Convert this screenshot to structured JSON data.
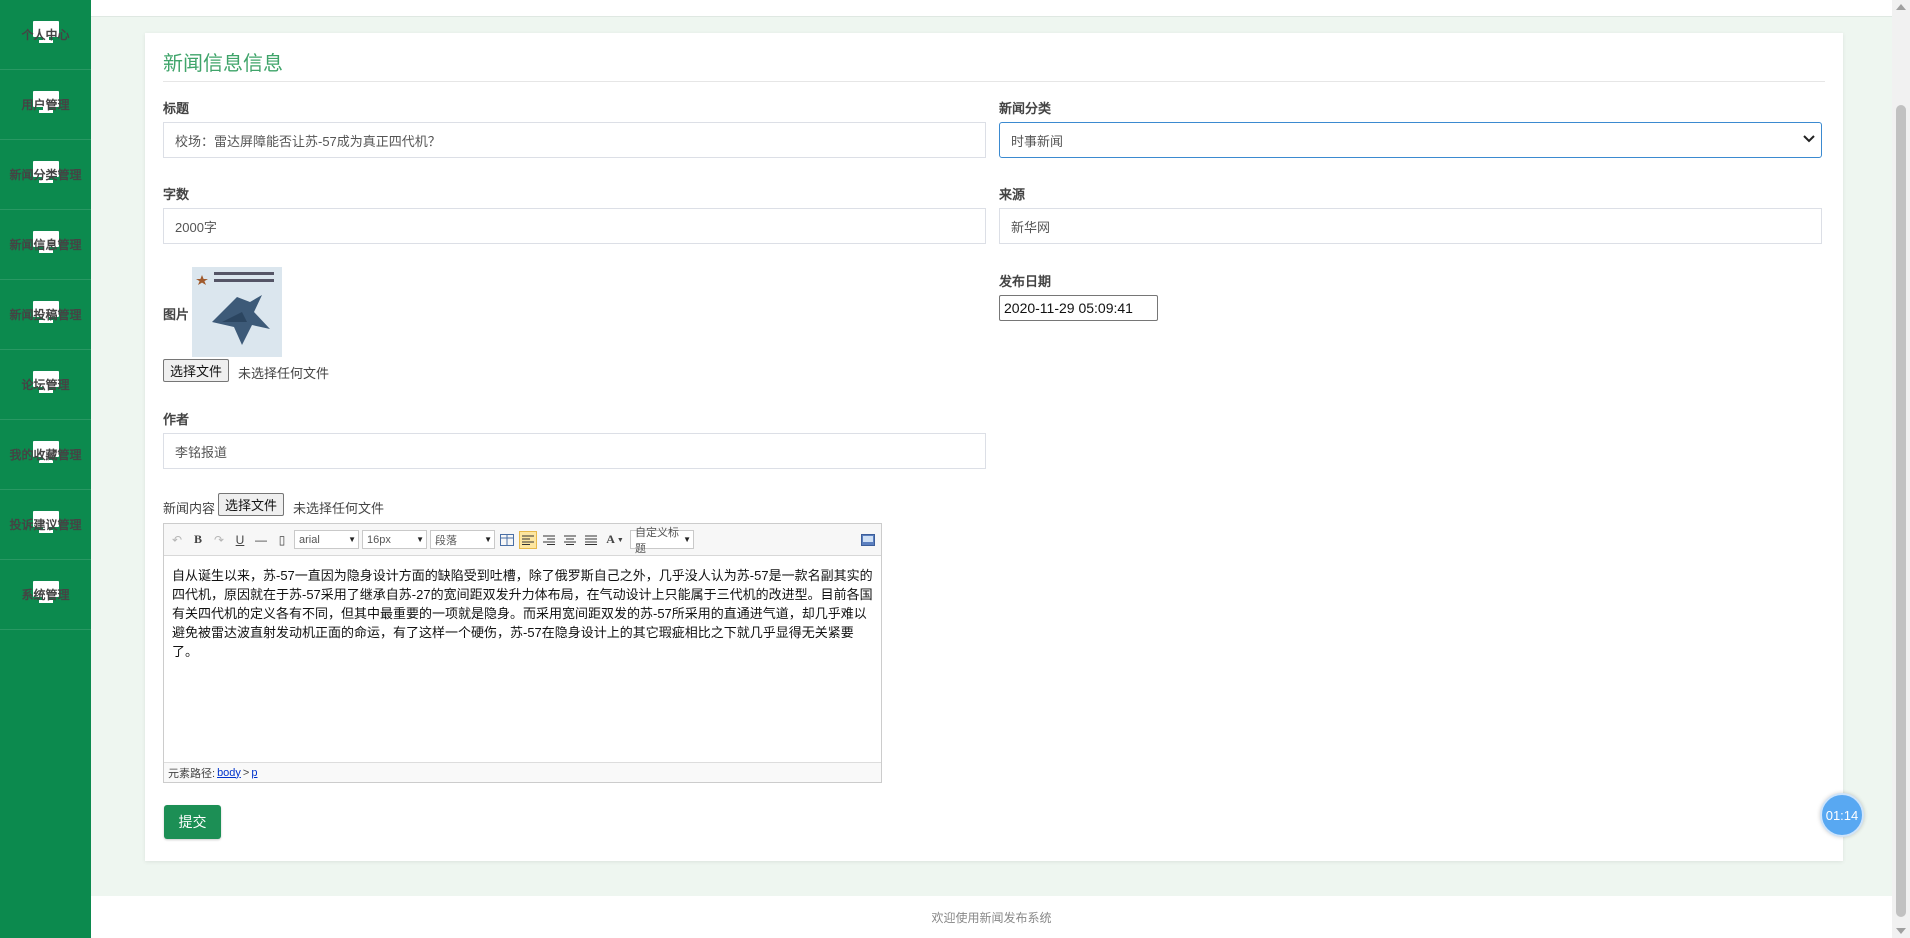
{
  "sidebar": {
    "items": [
      {
        "label": "个人中心"
      },
      {
        "label": "用户管理"
      },
      {
        "label": "新闻分类管理"
      },
      {
        "label": "新闻信息管理"
      },
      {
        "label": "新闻投稿管理"
      },
      {
        "label": "论坛管理"
      },
      {
        "label": "我的收藏管理"
      },
      {
        "label": "投诉建议管理"
      },
      {
        "label": "系统管理"
      }
    ]
  },
  "form": {
    "title": "新闻信息信息",
    "headline_label": "标题",
    "headline_value": "校场：雷达屏障能否让苏-57成为真正四代机？",
    "category_label": "新闻分类",
    "category_value": "时事新闻",
    "wordcount_label": "字数",
    "wordcount_value": "2000字",
    "source_label": "来源",
    "source_value": "新华网",
    "image_label": "图片",
    "pubdate_label": "发布日期",
    "pubdate_value": "2020-11-29 05:09:41",
    "file_button": "选择文件",
    "file_none": "未选择任何文件",
    "author_label": "作者",
    "author_value": "李铭报道",
    "content_label": "新闻内容",
    "submit_label": "提交"
  },
  "editor": {
    "font_family": "arial",
    "font_size": "16px",
    "paragraph": "段落",
    "custom_title": "自定义标题",
    "content": "自从诞生以来，苏-57一直因为隐身设计方面的缺陷受到吐槽，除了俄罗斯自己之外，几乎没人认为苏-57是一款名副其实的四代机，原因就在于苏-57采用了继承自苏-27的宽间距双发升力体布局，在气动设计上只能属于三代机的改进型。目前各国有关四代机的定义各有不同，但其中最重要的一项就是隐身。而采用宽间距双发的苏-57所采用的直通进气道，却几乎难以避免被雷达波直射发动机正面的命运，有了这样一个硬伤，苏-57在隐身设计上的其它瑕疵相比之下就几乎显得无关紧要了。",
    "path_label": "元素路径:",
    "path_body": "body",
    "path_sep": ">",
    "path_p": "p"
  },
  "footer": {
    "text": "欢迎使用新闻发布系统"
  },
  "timer": {
    "text": "01:14"
  },
  "colors": {
    "sidebar": "#0c8a4e",
    "title": "#3fa46a",
    "submit": "#1c8f55",
    "timer": "#58a8f2"
  }
}
